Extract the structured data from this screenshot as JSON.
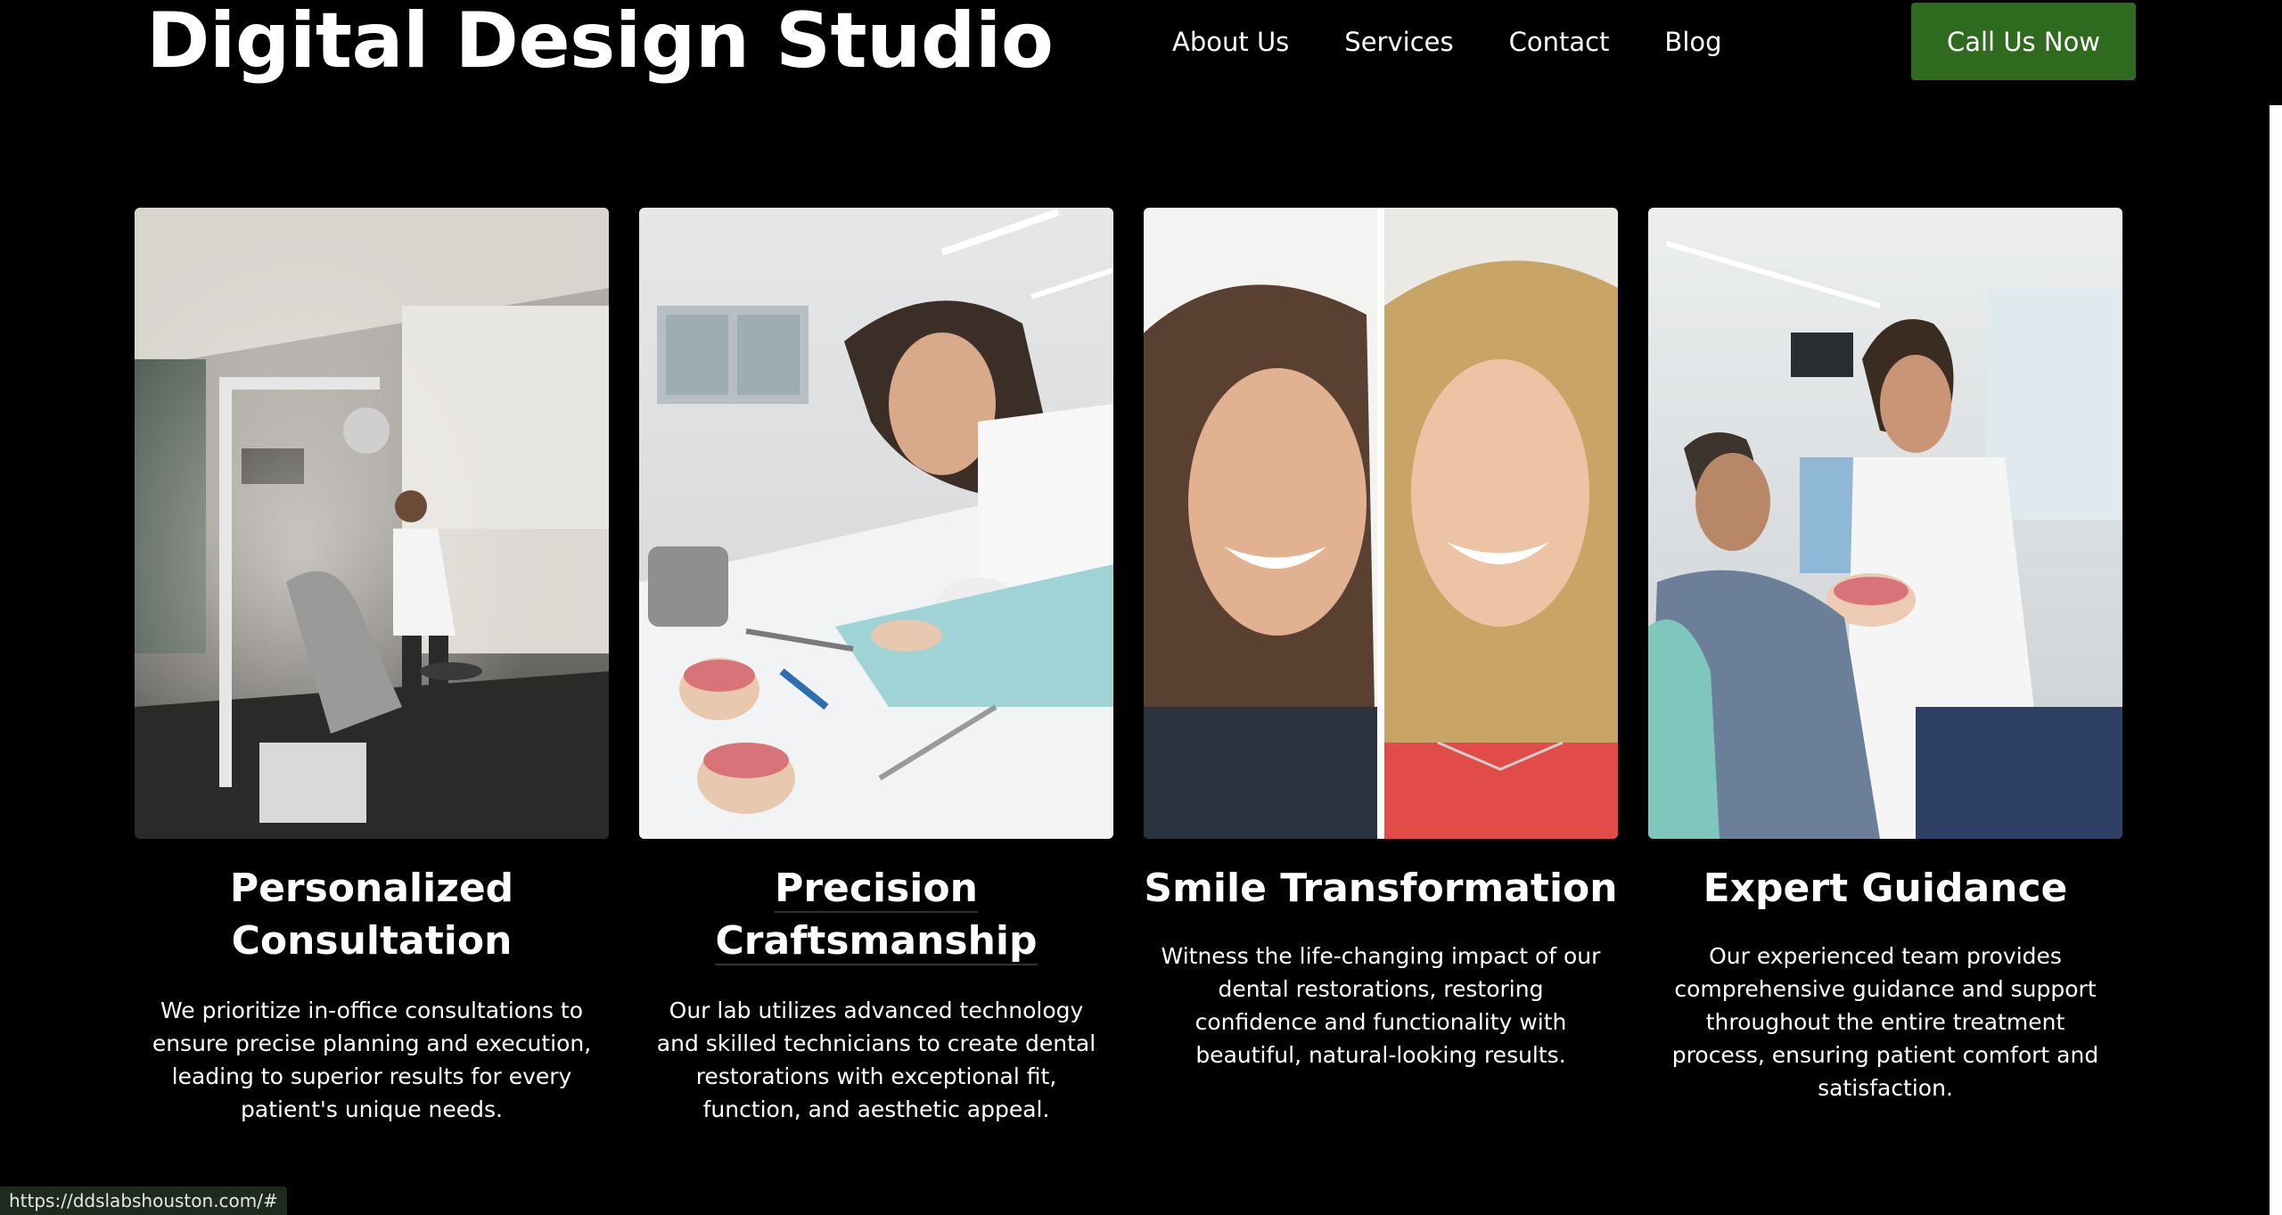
{
  "header": {
    "title": "Digital Design Studio",
    "nav": [
      {
        "label": "About Us"
      },
      {
        "label": "Services"
      },
      {
        "label": "Contact"
      },
      {
        "label": "Blog"
      }
    ],
    "cta_label": "Call Us Now"
  },
  "cards": [
    {
      "title_line1": "Personalized",
      "title_line2": "Consultation",
      "text": "We prioritize in-office consultations to ensure precise planning and execution, leading to superior results for every patient's unique needs."
    },
    {
      "title_line1": "Precision",
      "title_line2": "Craftsmanship",
      "text": "Our lab utilizes advanced technology and skilled technicians to create dental restorations with exceptional fit, function, and aesthetic appeal."
    },
    {
      "title_line1": "Smile Transformation",
      "text": "Witness the life-changing impact of our dental restorations, restoring confidence and functionality with beautiful, natural-looking results."
    },
    {
      "title_line1": "Expert Guidance",
      "text": "Our experienced team provides comprehensive guidance and support throughout the entire treatment process, ensuring patient comfort and satisfaction."
    }
  ],
  "status_bar": {
    "url": "https://ddslabshouston.com/#"
  },
  "colors": {
    "background": "#000000",
    "cta_background": "#2e6b1f",
    "text": "#ffffff"
  }
}
